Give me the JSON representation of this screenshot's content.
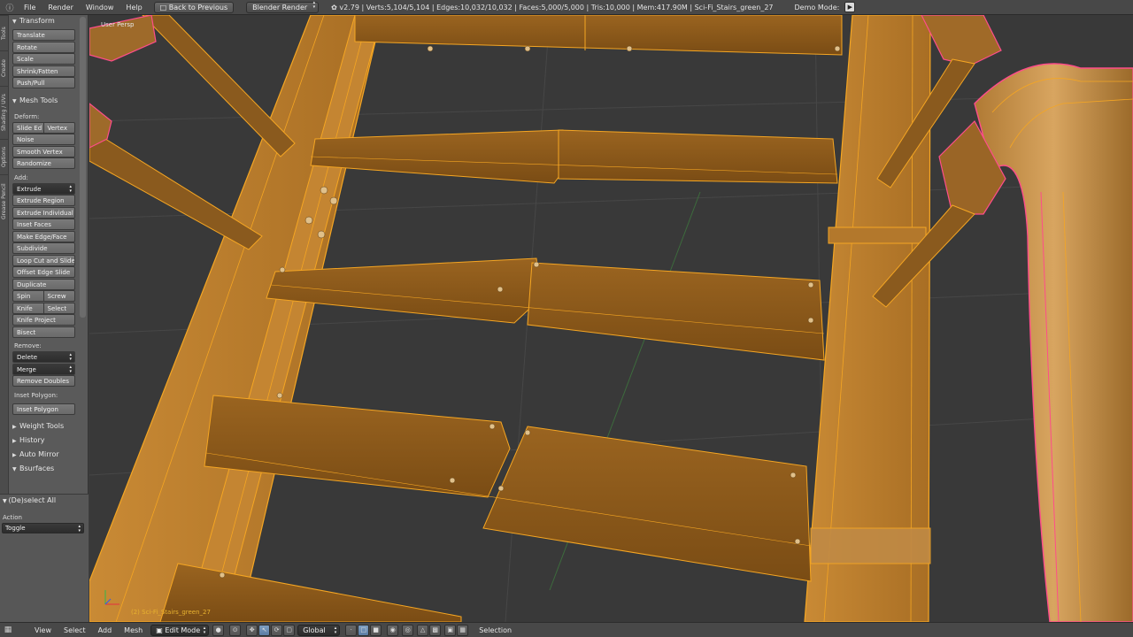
{
  "topbar": {
    "menus": [
      "File",
      "Render",
      "Window",
      "Help"
    ],
    "back_button": "Back to Previous",
    "engine": "Blender Render",
    "stats": "v2.79 | Verts:5,104/5,104 | Edges:10,032/10,032 | Faces:5,000/5,000 | Tris:10,000 | Mem:417.90M | Sci-Fi_Stairs_green_27",
    "demo_mode": "Demo Mode:"
  },
  "tool_tabs": [
    "Tools",
    "Create",
    "Shading / UVs",
    "Options",
    "Grease Pencil"
  ],
  "transform": {
    "title": "Transform",
    "buttons": [
      "Translate",
      "Rotate",
      "Scale",
      "Shrink/Fatten",
      "Push/Pull"
    ]
  },
  "mesh_tools": {
    "title": "Mesh Tools",
    "deform_label": "Deform:",
    "slide_edge": "Slide Ed",
    "vertex": "Vertex",
    "noise": "Noise",
    "smooth_vertex": "Smooth Vertex",
    "randomize": "Randomize",
    "add_label": "Add:",
    "extrude": "Extrude",
    "extrude_region": "Extrude Region",
    "extrude_individual": "Extrude Individual",
    "inset_faces": "Inset Faces",
    "make_edge_face": "Make Edge/Face",
    "subdivide": "Subdivide",
    "loop_cut_slide": "Loop Cut and Slide",
    "offset_edge_slide": "Offset Edge Slide",
    "duplicate": "Duplicate",
    "spin": "Spin",
    "screw": "Screw",
    "knife": "Knife",
    "select": "Select",
    "knife_project": "Knife Project",
    "bisect": "Bisect",
    "remove_label": "Remove:",
    "delete": "Delete",
    "merge": "Merge",
    "remove_doubles": "Remove Doubles",
    "inset_polygon_label": "Inset Polygon:",
    "inset_polygon": "Inset Polygon"
  },
  "collapsed_panels": [
    "Weight Tools",
    "History",
    "Auto Mirror",
    "Bsurfaces"
  ],
  "operator": {
    "title": "(De)select All",
    "action_label": "Action",
    "action_value": "Toggle"
  },
  "viewport": {
    "view_label": "User Persp",
    "object_name": "(2) Sci-Fi_Stairs_green_27",
    "colors": {
      "background": "#393939",
      "grid": "#474747",
      "selected_wire": "#f5a623",
      "active_wire": "#ff4d8a",
      "wood": "#b37a2e"
    }
  },
  "bottombar": {
    "menus": [
      "View",
      "Select",
      "Add",
      "Mesh"
    ],
    "mode": "Edit Mode",
    "orientation": "Global",
    "selection_label": "Selection"
  }
}
